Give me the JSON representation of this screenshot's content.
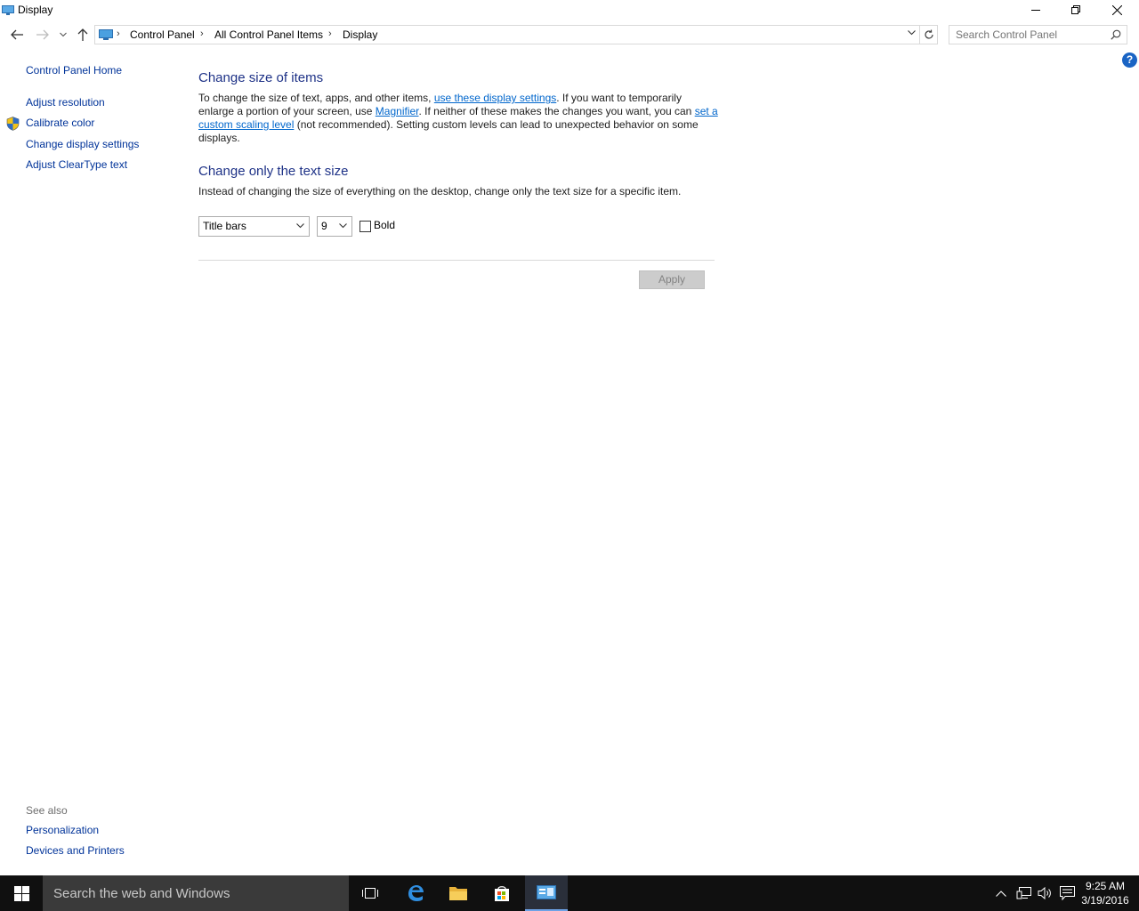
{
  "window": {
    "title": "Display",
    "minimize": "minimize",
    "restore": "restore",
    "close": "close"
  },
  "address": {
    "breadcrumbs": [
      "Control Panel",
      "All Control Panel Items",
      "Display"
    ],
    "search_placeholder": "Search Control Panel"
  },
  "help_label": "?",
  "sidebar": {
    "home": "Control Panel Home",
    "items": [
      {
        "label": "Adjust resolution",
        "icon": null
      },
      {
        "label": "Calibrate color",
        "icon": "shield-icon"
      },
      {
        "label": "Change display settings",
        "icon": null
      },
      {
        "label": "Adjust ClearType text",
        "icon": null
      }
    ],
    "see_also_title": "See also",
    "see_also": [
      "Personalization",
      "Devices and Printers"
    ]
  },
  "main": {
    "section1_title": "Change size of items",
    "section1_text_a": "To change the size of text, apps, and other items, ",
    "section1_link1": "use these display settings",
    "section1_text_b": ".  If you want to temporarily enlarge a portion of your screen, use ",
    "section1_link2": "Magnifier",
    "section1_text_c": ".  If neither of these makes the changes you want, you can ",
    "section1_link3": "set a custom scaling level",
    "section1_text_d": " (not recommended).  Setting custom levels can lead to unexpected behavior on some displays.",
    "section2_title": "Change only the text size",
    "section2_text": "Instead of changing the size of everything on the desktop, change only the text size for a specific item.",
    "item_select_value": "Title bars",
    "size_select_value": "9",
    "bold_label": "Bold",
    "bold_checked": false,
    "apply_label": "Apply"
  },
  "taskbar": {
    "search_placeholder": "Search the web and Windows",
    "time": "9:25 AM",
    "date": "3/19/2016",
    "accent": "#6ea2e6"
  }
}
